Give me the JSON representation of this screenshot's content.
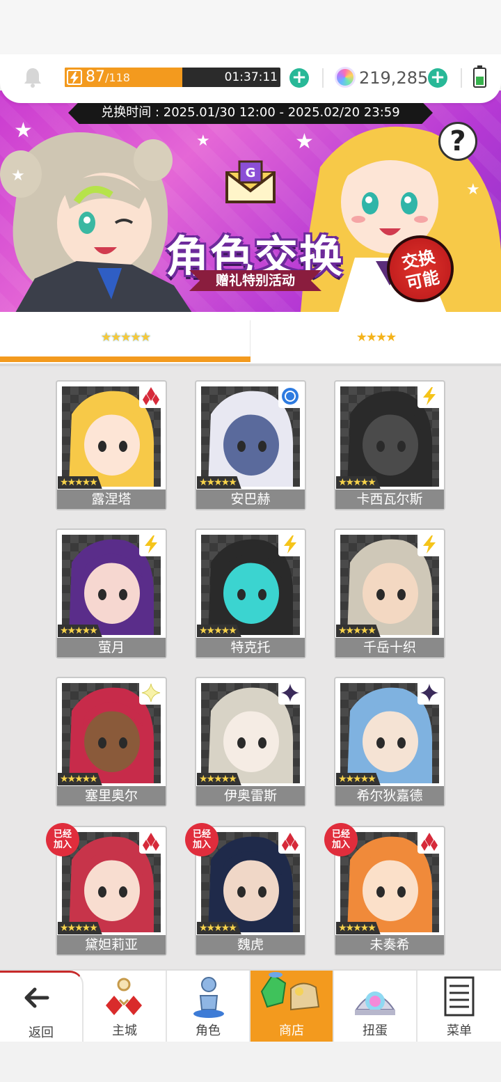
{
  "topbar": {
    "energy_current": "87",
    "energy_max": "/118",
    "energy_fraction": 0.737,
    "energy_timer": "01:37:11",
    "gems": "219,285"
  },
  "banner": {
    "exchange_time": "兑换时间 : 2025.01/30 12:00 - 2025.02/20 23:59",
    "title": "角色交换",
    "subtitle": "赠礼特别活动",
    "badge": "交换可能",
    "badge_line1": "交换",
    "badge_line2": "可能",
    "help": "?"
  },
  "tabs": [
    {
      "label": "★★★★★",
      "active": true
    },
    {
      "label": "★★★★",
      "active": false
    }
  ],
  "characters": [
    {
      "name": "露涅塔",
      "rarity": "★★★★★",
      "attribute": "diamond-icon",
      "joined": false
    },
    {
      "name": "安巴赫",
      "rarity": "★★★★★",
      "attribute": "circle-icon",
      "joined": false
    },
    {
      "name": "卡西瓦尔斯",
      "rarity": "★★★★★",
      "attribute": "lightning-icon",
      "joined": false
    },
    {
      "name": "萤月",
      "rarity": "★★★★★",
      "attribute": "lightning-icon",
      "joined": false
    },
    {
      "name": "特克托",
      "rarity": "★★★★★",
      "attribute": "lightning-icon",
      "joined": false
    },
    {
      "name": "千岳十织",
      "rarity": "★★★★★",
      "attribute": "lightning-icon",
      "joined": false
    },
    {
      "name": "塞里奥尔",
      "rarity": "★★★★★",
      "attribute": "sparkle-icon",
      "joined": false
    },
    {
      "name": "伊奥雷斯",
      "rarity": "★★★★★",
      "attribute": "dark-star-icon",
      "joined": false
    },
    {
      "name": "希尔狄嘉德",
      "rarity": "★★★★★",
      "attribute": "dark-star-icon",
      "joined": false
    },
    {
      "name": "黛妲莉亚",
      "rarity": "★★★★★",
      "attribute": "diamond-icon",
      "joined": true
    },
    {
      "name": "魏虎",
      "rarity": "★★★★★",
      "attribute": "diamond-icon",
      "joined": true
    },
    {
      "name": "未奏希",
      "rarity": "★★★★★",
      "attribute": "diamond-icon",
      "joined": true
    }
  ],
  "joined_label_1": "已经",
  "joined_label_2": "加入",
  "nav": [
    {
      "label": "返回",
      "icon": "back-arrow-icon"
    },
    {
      "label": "主城",
      "icon": "castle-icon"
    },
    {
      "label": "角色",
      "icon": "character-icon"
    },
    {
      "label": "商店",
      "icon": "shop-icon",
      "active": true
    },
    {
      "label": "扭蛋",
      "icon": "gacha-icon"
    },
    {
      "label": "菜单",
      "icon": "menu-icon"
    }
  ],
  "colors": {
    "accent": "#f39a1e",
    "plus": "#28b897",
    "joined_badge": "#e02d3c",
    "name_bar": "#8a8a8a"
  }
}
